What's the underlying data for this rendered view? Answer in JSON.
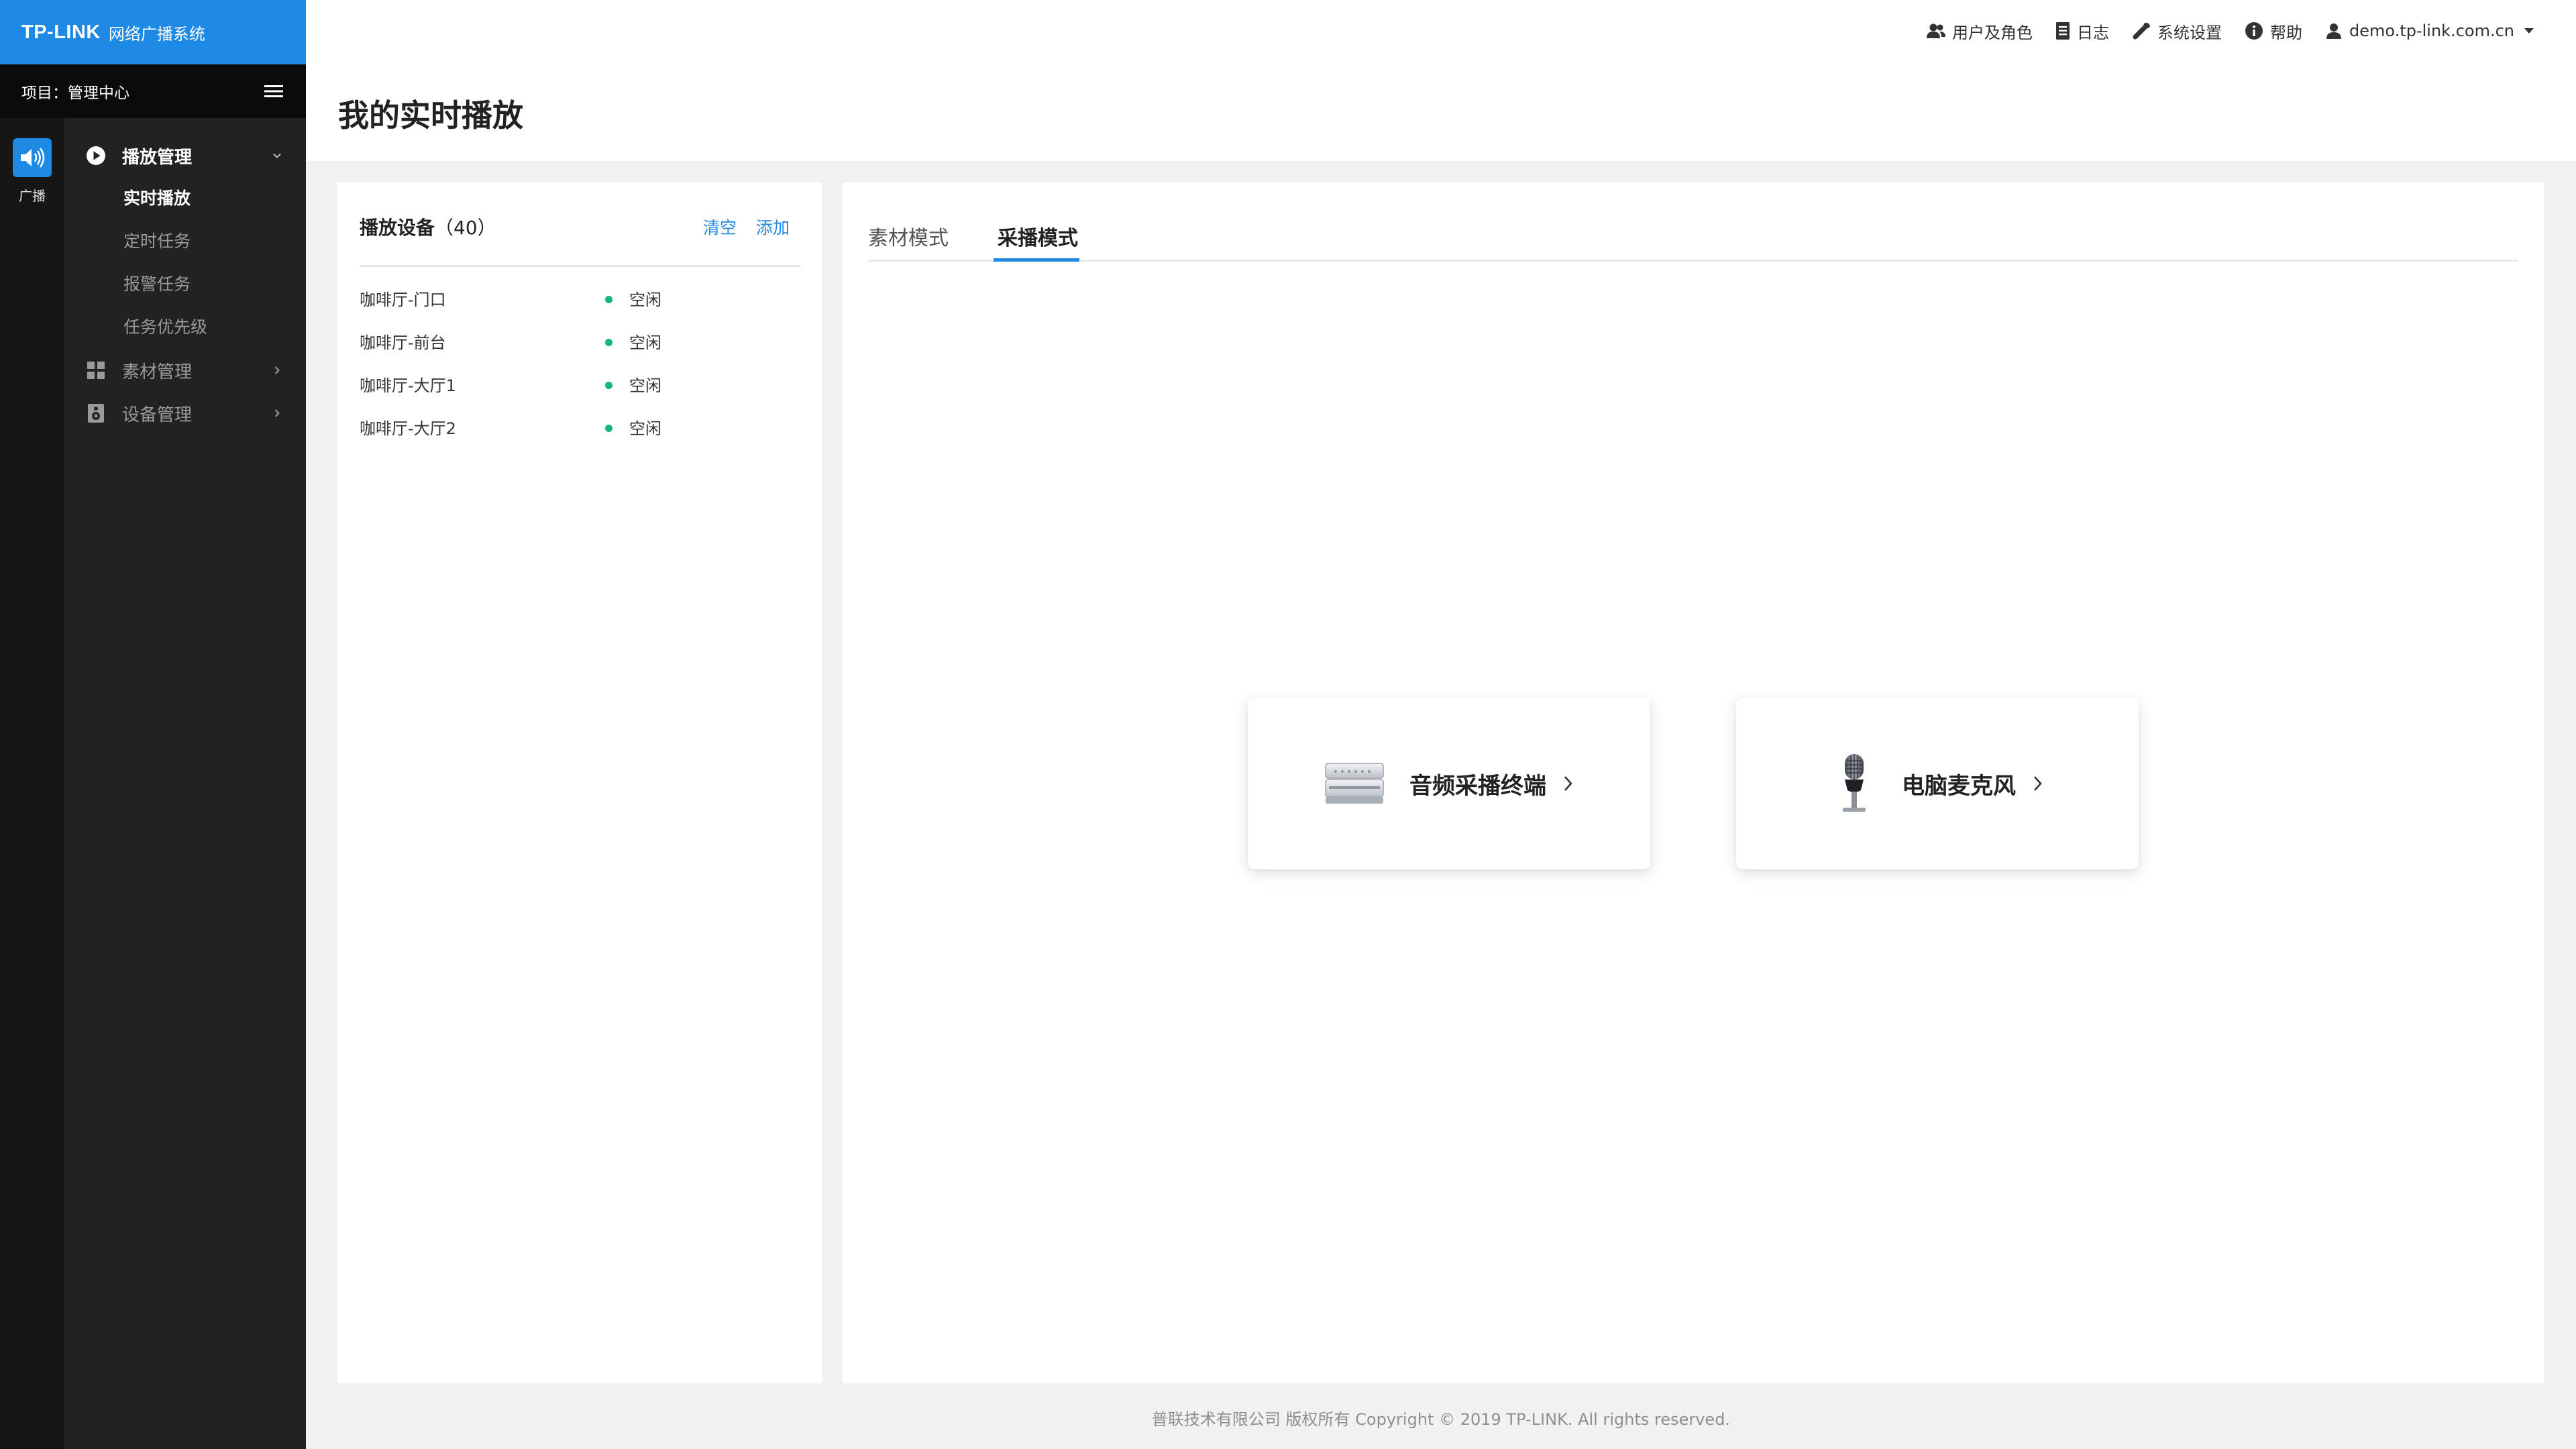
{
  "brand": {
    "logo": "TP-LINK",
    "title": "网络广播系统"
  },
  "project": {
    "label": "项目：管理中心"
  },
  "rail": {
    "label": "广播"
  },
  "sidebar": {
    "groups": [
      {
        "label": "播放管理",
        "items": [
          "实时播放",
          "定时任务",
          "报警任务",
          "任务优先级"
        ]
      },
      {
        "label": "素材管理"
      },
      {
        "label": "设备管理"
      }
    ]
  },
  "topbar": {
    "users": "用户及角色",
    "log": "日志",
    "settings": "系统设置",
    "help": "帮助",
    "account": "demo.tp-link.com.cn"
  },
  "page": {
    "title": "我的实时播放"
  },
  "devices": {
    "title": "播放设备",
    "count": "（40）",
    "clear": "清空",
    "add": "添加",
    "list": [
      {
        "name": "咖啡厅-门口",
        "status": "空闲"
      },
      {
        "name": "咖啡厅-前台",
        "status": "空闲"
      },
      {
        "name": "咖啡厅-大厅1",
        "status": "空闲"
      },
      {
        "name": "咖啡厅-大厅2",
        "status": "空闲"
      }
    ]
  },
  "tabs": {
    "items": [
      "素材模式",
      "采播模式"
    ],
    "active": 1
  },
  "cards": [
    {
      "label": "音频采播终端",
      "icon": "audio-terminal-icon"
    },
    {
      "label": "电脑麦克风",
      "icon": "microphone-icon"
    }
  ],
  "colors": {
    "accent": "#1e88e5",
    "idle": "#14b57a",
    "sidebar": "#222222",
    "rail": "#161616"
  },
  "footer": {
    "text": "普联技术有限公司 版权所有 Copyright © 2019 TP-LINK. All rights reserved."
  }
}
